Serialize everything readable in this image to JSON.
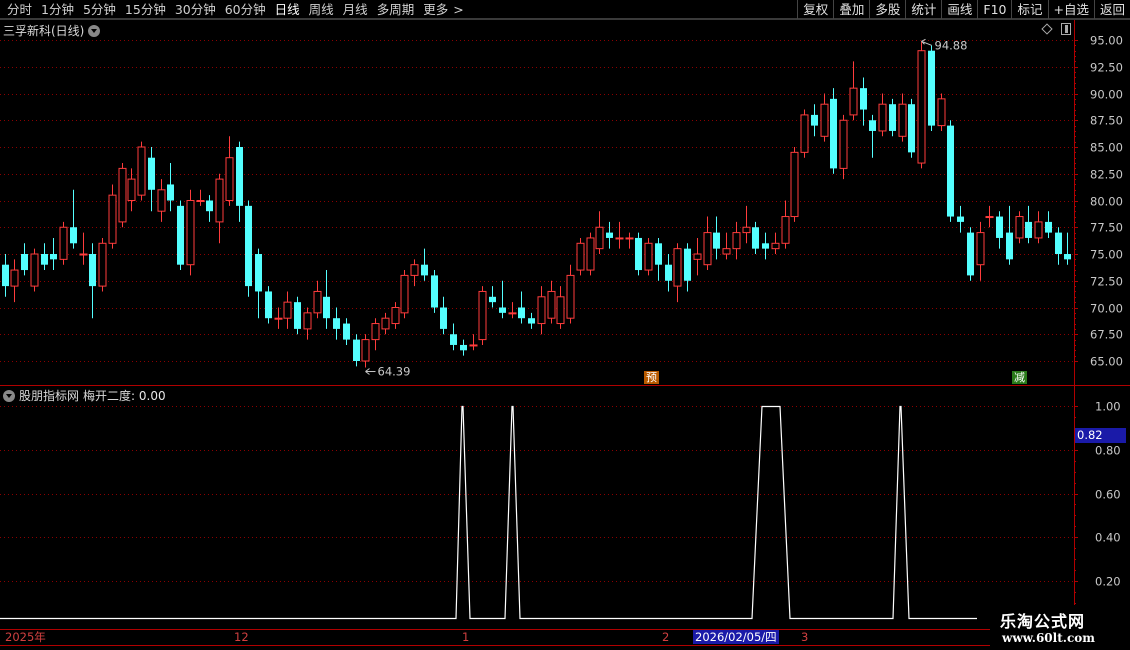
{
  "toolbar": {
    "periods": [
      "分时",
      "1分钟",
      "5分钟",
      "15分钟",
      "30分钟",
      "60分钟",
      "日线",
      "周线",
      "月线",
      "多周期",
      "更多"
    ],
    "active_period": "日线",
    "actions": [
      "复权",
      "叠加",
      "多股",
      "统计",
      "画线",
      "F10",
      "标记",
      "+自选",
      "返回"
    ]
  },
  "main_chart": {
    "title": "三孚新科(日线)",
    "price_axis": [
      "95.00",
      "92.50",
      "90.00",
      "87.50",
      "85.00",
      "82.50",
      "80.00",
      "77.50",
      "75.00",
      "72.50",
      "70.00",
      "67.50",
      "65.00"
    ],
    "high_label": "94.88",
    "low_label": "64.39",
    "tag_yu": "预",
    "tag_jian": "减",
    "colors": {
      "up": "#ff3c3c",
      "down": "#54ffff",
      "grid": "#8b0000",
      "frame": "#b00000"
    }
  },
  "indicator": {
    "title": "股朋指标网",
    "line_name": "梅开二度",
    "value_text": ": 0.00",
    "axis": [
      "1.00",
      "0.80",
      "0.60",
      "0.40",
      "0.20"
    ],
    "current_value": "0.82"
  },
  "date_axis": {
    "labels": [
      "2025年",
      "12",
      "1",
      "2",
      "3"
    ],
    "highlight": "2026/02/05/四"
  },
  "watermark": {
    "name": "乐淘公式网",
    "url": "www.60lt.com"
  },
  "chart_data": {
    "type": "candlestick",
    "ylim": [
      63.5,
      96.5
    ],
    "candles": [
      [
        74.0,
        72.0,
        75.0,
        71.0
      ],
      [
        72.0,
        73.5,
        74.5,
        70.5
      ],
      [
        75.0,
        73.5,
        76.0,
        73.0
      ],
      [
        72.0,
        75.0,
        75.5,
        71.5
      ],
      [
        75.0,
        74.0,
        76.0,
        73.5
      ],
      [
        75.0,
        74.5,
        76.5,
        73.5
      ],
      [
        74.5,
        77.5,
        78.0,
        74.0
      ],
      [
        77.5,
        76.0,
        81.0,
        75.5
      ],
      [
        75.0,
        75.0,
        77.0,
        74.0
      ],
      [
        75.0,
        72.0,
        76.0,
        69.0
      ],
      [
        72.0,
        76.0,
        76.5,
        71.5
      ],
      [
        76.0,
        80.5,
        81.5,
        75.5
      ],
      [
        78.0,
        83.0,
        83.5,
        77.5
      ],
      [
        80.0,
        82.0,
        83.0,
        79.0
      ],
      [
        80.5,
        85.0,
        85.5,
        80.0
      ],
      [
        84.0,
        81.0,
        85.0,
        79.0
      ],
      [
        79.0,
        81.0,
        82.0,
        78.0
      ],
      [
        81.5,
        80.0,
        83.5,
        79.0
      ],
      [
        79.5,
        74.0,
        80.0,
        73.5
      ],
      [
        74.0,
        80.0,
        81.0,
        73.0
      ],
      [
        80.0,
        80.0,
        81.0,
        79.5
      ],
      [
        80.0,
        79.0,
        80.5,
        78.0
      ],
      [
        78.0,
        82.0,
        82.5,
        76.0
      ],
      [
        80.0,
        84.0,
        86.0,
        79.5
      ],
      [
        85.0,
        79.5,
        85.5,
        78.0
      ],
      [
        79.5,
        72.0,
        80.0,
        71.0
      ],
      [
        75.0,
        71.5,
        75.5,
        69.0
      ],
      [
        71.5,
        69.0,
        72.0,
        68.5
      ],
      [
        69.0,
        69.0,
        70.0,
        68.0
      ],
      [
        69.0,
        70.5,
        71.5,
        68.0
      ],
      [
        70.5,
        68.0,
        71.0,
        67.5
      ],
      [
        68.0,
        69.5,
        70.0,
        67.0
      ],
      [
        69.5,
        71.5,
        72.5,
        69.0
      ],
      [
        71.0,
        69.0,
        73.5,
        68.0
      ],
      [
        69.0,
        68.0,
        70.0,
        67.0
      ],
      [
        68.5,
        67.0,
        69.0,
        66.5
      ],
      [
        67.0,
        65.0,
        67.5,
        64.5
      ],
      [
        65.0,
        67.0,
        67.5,
        64.39
      ],
      [
        67.0,
        68.5,
        69.0,
        66.0
      ],
      [
        68.0,
        69.0,
        69.5,
        67.5
      ],
      [
        68.5,
        70.0,
        70.5,
        68.0
      ],
      [
        69.5,
        73.0,
        73.5,
        69.0
      ],
      [
        73.0,
        74.0,
        74.5,
        72.0
      ],
      [
        74.0,
        73.0,
        75.5,
        72.5
      ],
      [
        73.0,
        70.0,
        73.5,
        69.5
      ],
      [
        70.0,
        68.0,
        71.0,
        67.5
      ],
      [
        67.5,
        66.5,
        68.5,
        66.0
      ],
      [
        66.5,
        66.0,
        67.0,
        65.5
      ],
      [
        66.5,
        66.5,
        67.5,
        66.0
      ],
      [
        67.0,
        71.5,
        72.0,
        66.5
      ],
      [
        71.0,
        70.5,
        72.0,
        70.0
      ],
      [
        70.0,
        69.5,
        72.5,
        69.0
      ],
      [
        69.5,
        69.5,
        70.5,
        69.0
      ],
      [
        70.0,
        69.0,
        71.5,
        68.5
      ],
      [
        69.0,
        68.5,
        69.5,
        68.0
      ],
      [
        68.5,
        71.0,
        72.0,
        67.5
      ],
      [
        69.0,
        71.5,
        72.5,
        68.5
      ],
      [
        68.5,
        71.0,
        72.0,
        68.0
      ],
      [
        69.0,
        73.0,
        74.0,
        68.5
      ],
      [
        73.5,
        76.0,
        76.5,
        73.0
      ],
      [
        73.5,
        76.5,
        77.0,
        73.0
      ],
      [
        75.5,
        77.5,
        79.0,
        75.0
      ],
      [
        77.0,
        76.5,
        78.0,
        75.5
      ],
      [
        76.5,
        76.5,
        78.0,
        75.5
      ],
      [
        76.5,
        76.5,
        77.0,
        75.5
      ],
      [
        76.5,
        73.5,
        77.0,
        73.0
      ],
      [
        73.5,
        76.0,
        76.5,
        73.0
      ],
      [
        76.0,
        74.0,
        76.5,
        72.5
      ],
      [
        74.0,
        72.5,
        75.0,
        71.5
      ],
      [
        72.0,
        75.5,
        76.0,
        70.5
      ],
      [
        75.5,
        72.5,
        76.0,
        71.5
      ],
      [
        74.5,
        75.0,
        76.5,
        73.0
      ],
      [
        74.0,
        77.0,
        78.5,
        73.5
      ],
      [
        77.0,
        75.5,
        78.5,
        74.5
      ],
      [
        75.0,
        75.5,
        77.0,
        74.5
      ],
      [
        75.5,
        77.0,
        78.0,
        74.5
      ],
      [
        77.0,
        77.5,
        79.5,
        76.0
      ],
      [
        77.5,
        75.5,
        78.0,
        75.0
      ],
      [
        76.0,
        75.5,
        77.0,
        74.5
      ],
      [
        75.5,
        76.0,
        77.0,
        75.0
      ],
      [
        76.0,
        78.5,
        80.0,
        75.5
      ],
      [
        78.5,
        84.5,
        85.0,
        78.0
      ],
      [
        84.5,
        88.0,
        88.5,
        84.0
      ],
      [
        88.0,
        87.0,
        89.0,
        86.0
      ],
      [
        86.0,
        89.0,
        90.0,
        85.5
      ],
      [
        89.5,
        83.0,
        90.5,
        82.5
      ],
      [
        83.0,
        87.5,
        88.0,
        82.0
      ],
      [
        88.0,
        90.5,
        93.0,
        87.5
      ],
      [
        90.5,
        88.5,
        91.5,
        87.0
      ],
      [
        87.5,
        86.5,
        88.0,
        84.0
      ],
      [
        86.5,
        89.0,
        90.0,
        86.0
      ],
      [
        89.0,
        86.5,
        89.5,
        86.0
      ],
      [
        86.0,
        89.0,
        90.0,
        85.5
      ],
      [
        89.0,
        84.5,
        89.5,
        84.0
      ],
      [
        83.5,
        94.0,
        94.88,
        83.0
      ],
      [
        94.0,
        87.0,
        94.5,
        86.5
      ],
      [
        87.0,
        89.5,
        90.0,
        86.5
      ],
      [
        87.0,
        78.5,
        87.5,
        78.0
      ],
      [
        78.5,
        78.0,
        79.5,
        77.0
      ],
      [
        77.0,
        73.0,
        77.5,
        72.5
      ],
      [
        74.0,
        77.0,
        78.0,
        72.5
      ],
      [
        78.5,
        78.5,
        79.5,
        77.5
      ],
      [
        78.5,
        76.5,
        79.0,
        75.5
      ],
      [
        77.0,
        74.5,
        79.5,
        74.0
      ],
      [
        76.5,
        78.5,
        79.0,
        76.0
      ],
      [
        78.0,
        76.5,
        79.5,
        76.0
      ],
      [
        76.5,
        78.0,
        79.0,
        76.0
      ],
      [
        78.0,
        77.0,
        79.0,
        76.5
      ],
      [
        77.0,
        75.0,
        77.5,
        74.0
      ],
      [
        75.0,
        74.5,
        77.0,
        74.0
      ]
    ],
    "indicator_peaks": [
      {
        "start": 456,
        "top1": 462,
        "top2": 463,
        "end": 470
      },
      {
        "start": 505,
        "top1": 512,
        "top2": 513,
        "end": 520
      },
      {
        "start": 752,
        "top1": 762,
        "top2": 780,
        "end": 790
      },
      {
        "start": 893,
        "top1": 900,
        "top2": 901,
        "end": 909
      }
    ]
  }
}
